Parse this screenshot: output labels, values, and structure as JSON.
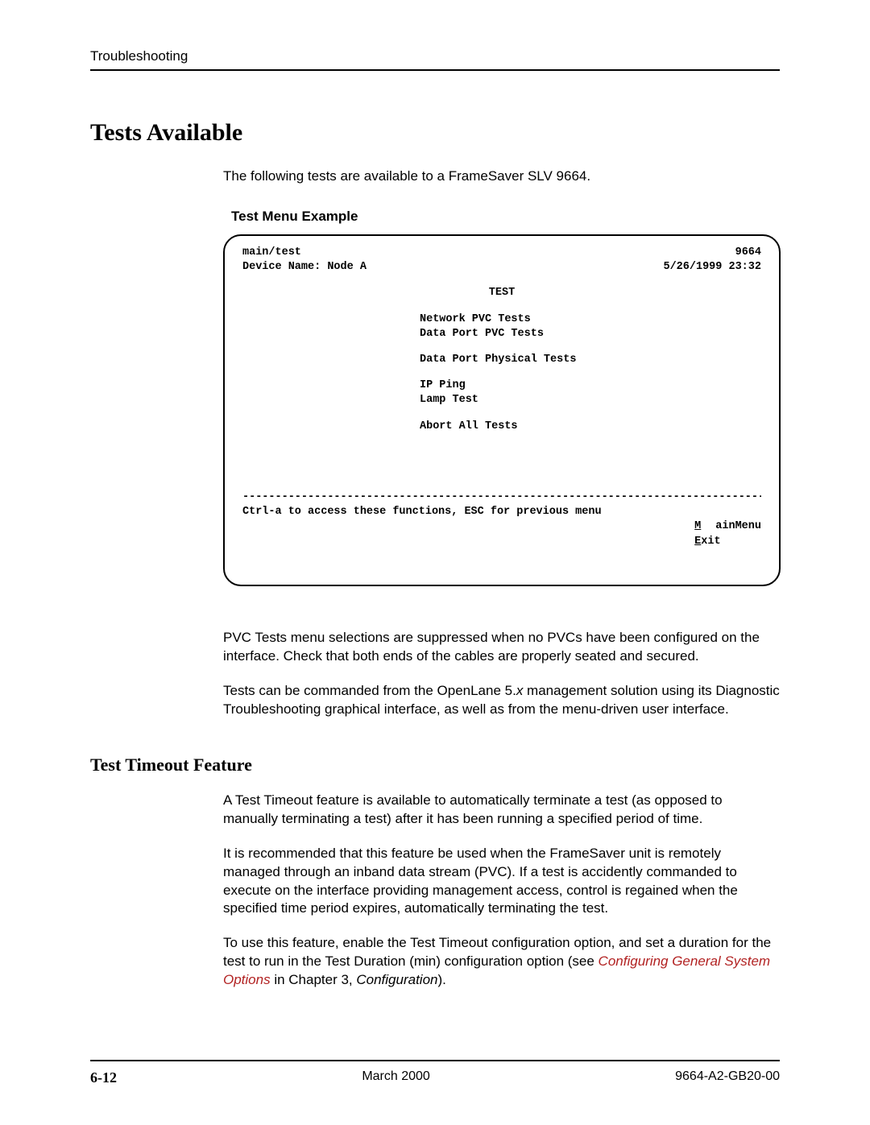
{
  "header": {
    "section": "Troubleshooting"
  },
  "title": "Tests Available",
  "intro": "The following tests are available to a FrameSaver SLV 9664.",
  "example_title": "Test Menu Example",
  "terminal": {
    "path": "main/test",
    "model": "9664",
    "device_label": "Device Name: Node A",
    "timestamp": "5/26/1999 23:32",
    "screen_title": "TEST",
    "items": [
      "Network PVC Tests",
      "Data Port PVC Tests",
      "Data Port Physical Tests",
      "IP Ping",
      "Lamp Test",
      "Abort All Tests"
    ],
    "divider": "----------------------------------------------------------------------------------",
    "help": "Ctrl-a to access these functions, ESC for previous menu",
    "opt_main": "MainMenu",
    "opt_exit": "Exit"
  },
  "para1": "PVC Tests menu selections are suppressed when no PVCs have been configured on the interface. Check that both ends of the cables are properly seated and secured.",
  "para2_a": "Tests can be commanded from the OpenLane 5.",
  "para2_x": "x",
  "para2_b": " management solution using its Diagnostic Troubleshooting graphical interface, as well as from the menu-driven user interface.",
  "subhead": "Test Timeout Feature",
  "para3": "A Test Timeout feature is available to automatically terminate a test (as opposed to manually terminating a test) after it has been running a specified period of time.",
  "para4": "It is recommended that this feature be used when the FrameSaver unit is remotely managed through an inband data stream (PVC). If a test is accidently commanded to execute on the interface providing management access, control is regained when the specified time period expires, automatically terminating the test.",
  "para5_a": "To use this feature, enable the Test Timeout configuration option, and set a duration for the test to run in the Test Duration (min) configuration option (see ",
  "para5_link": "Configuring General System Options",
  "para5_b": " in Chapter 3, ",
  "para5_c": "Configuration",
  "para5_d": ").",
  "footer": {
    "page": "6-12",
    "date": "March 2000",
    "doc": "9664-A2-GB20-00"
  }
}
